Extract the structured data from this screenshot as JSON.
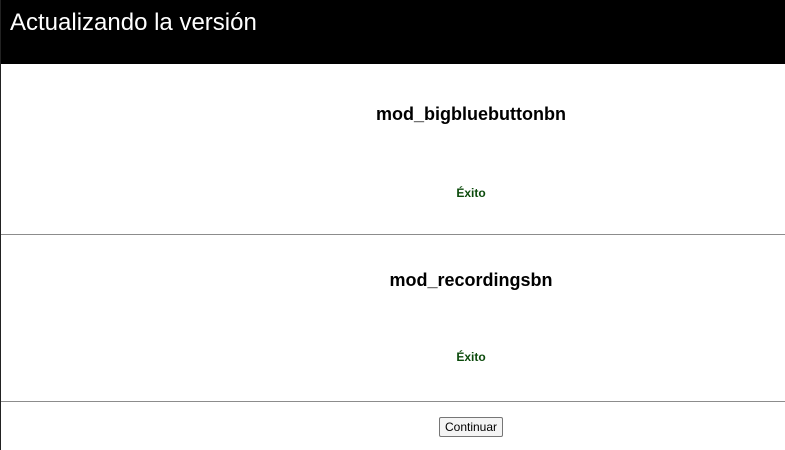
{
  "header": {
    "title": "Actualizando la versión"
  },
  "plugins": [
    {
      "name": "mod_bigbluebuttonbn",
      "status": "Éxito"
    },
    {
      "name": "mod_recordingsbn",
      "status": "Éxito"
    }
  ],
  "actions": {
    "continue_label": "Continuar"
  },
  "colors": {
    "header_bg": "#000000",
    "header_text": "#ffffff",
    "success_text": "#0b4a0b"
  }
}
